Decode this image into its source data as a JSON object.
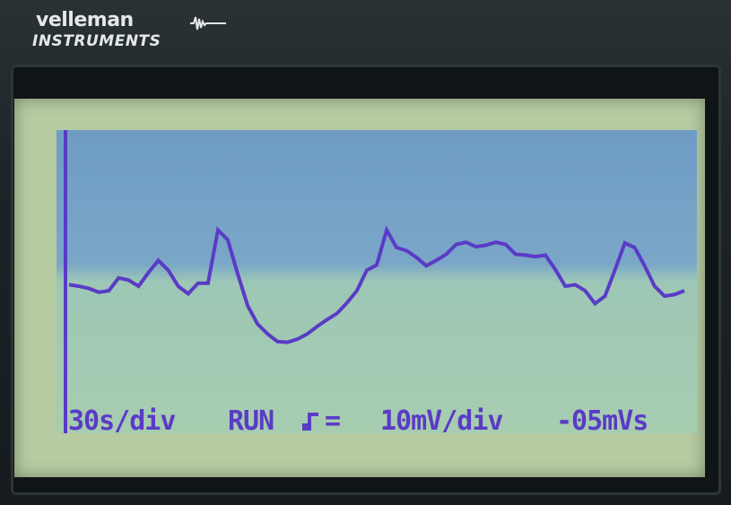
{
  "brand": {
    "name": "velleman",
    "line": "INSTRUMENTS"
  },
  "screen": {
    "timebase": "30s/div",
    "mode": "RUN",
    "coupling_icon": "dc-coupling-icon",
    "coupling_symbol": "=",
    "voltdiv": "10mV/div",
    "offset": "-05mVs"
  },
  "colors": {
    "trace": "#5a3bc6",
    "lcd_background": "#b6cba2",
    "plot_top": "#6f9cc4",
    "plot_bottom": "#a7cdb0"
  },
  "chart_data": {
    "type": "line",
    "grid": false,
    "series": [
      {
        "values": [
          -0.4,
          -0.6,
          -0.9,
          -1.4,
          -1.2,
          0.5,
          0.2,
          -0.6,
          1.2,
          2.8,
          1.5,
          -0.6,
          -1.6,
          -0.2,
          -0.2,
          6.8,
          5.5,
          1.0,
          -3.2,
          -5.6,
          -6.9,
          -7.9,
          -8.0,
          -7.6,
          -6.9,
          -5.9,
          -5.0,
          -4.2,
          -2.8,
          -1.2,
          1.5,
          2.2,
          6.8,
          4.5,
          4.1,
          3.2,
          2.1,
          2.8,
          3.6,
          4.9,
          5.2,
          4.6,
          4.8,
          5.2,
          4.9,
          3.6,
          3.5,
          3.3,
          3.5,
          1.6,
          -0.6,
          -0.4,
          -1.2,
          -2.9,
          -1.9,
          1.5,
          5.1,
          4.5,
          2.1,
          -0.6,
          -1.9,
          -1.7,
          -1.2
        ]
      }
    ],
    "ylim": [
      -20,
      20
    ]
  }
}
